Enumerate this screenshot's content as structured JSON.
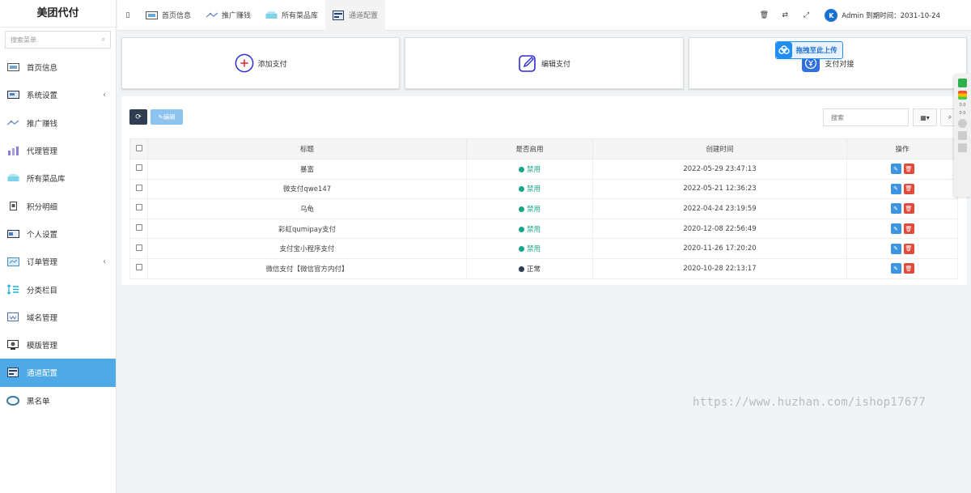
{
  "app": {
    "brand": "美团代付"
  },
  "sidebar": {
    "search_placeholder": "搜索菜单",
    "items": [
      {
        "label": "首页信息",
        "icon": "home-monitor-icon",
        "arrow": ""
      },
      {
        "label": "系统设置",
        "icon": "system-settings-icon",
        "arrow": "‹"
      },
      {
        "label": "推广赚钱",
        "icon": "promote-icon",
        "arrow": ""
      },
      {
        "label": "代理管理",
        "icon": "agent-chart-icon",
        "arrow": ""
      },
      {
        "label": "所有菜品库",
        "icon": "dishes-icon",
        "arrow": ""
      },
      {
        "label": "积分明细",
        "icon": "points-icon",
        "arrow": ""
      },
      {
        "label": "个人设置",
        "icon": "profile-icon",
        "arrow": ""
      },
      {
        "label": "订单管理",
        "icon": "orders-icon",
        "arrow": "‹"
      },
      {
        "label": "分类栏目",
        "icon": "category-icon",
        "arrow": ""
      },
      {
        "label": "域名管理",
        "icon": "domain-icon",
        "arrow": ""
      },
      {
        "label": "模版管理",
        "icon": "template-icon",
        "arrow": ""
      },
      {
        "label": "通道配置",
        "icon": "channel-icon",
        "arrow": ""
      },
      {
        "label": "黑名单",
        "icon": "blacklist-icon",
        "arrow": ""
      }
    ],
    "active_index": 11
  },
  "topbar": {
    "toggle": "▯",
    "tabs": [
      {
        "label": "首页信息",
        "icon": "home-monitor-icon"
      },
      {
        "label": "推广赚钱",
        "icon": "promote-icon"
      },
      {
        "label": "所有菜品库",
        "icon": "dishes-icon"
      },
      {
        "label": "通道配置",
        "icon": "channel-icon"
      }
    ],
    "active_tab": 3,
    "user_text": "Admin 到期时间：2031-10-24"
  },
  "cards": {
    "add_label": "添加支付",
    "edit_label": "编辑支付",
    "connect_label": "支付对接",
    "upload_tip": "拖拽至此上传"
  },
  "panel": {
    "edit_button": "编辑",
    "search_placeholder": "搜索",
    "columns": [
      "标题",
      "是否启用",
      "创建时间",
      "操作"
    ],
    "rows": [
      {
        "title": "暴富",
        "status": "禁用",
        "status_type": "off",
        "created": "2022-05-29 23:47:13"
      },
      {
        "title": "微支付qwe147",
        "status": "禁用",
        "status_type": "off",
        "created": "2022-05-21 12:36:23"
      },
      {
        "title": "乌龟",
        "status": "禁用",
        "status_type": "off",
        "created": "2022-04-24 23:19:59"
      },
      {
        "title": "彩虹qumipay支付",
        "status": "禁用",
        "status_type": "off",
        "created": "2020-12-08 22:56:49"
      },
      {
        "title": "支付宝小程序支付",
        "status": "禁用",
        "status_type": "off",
        "created": "2020-11-26 17:20:20"
      },
      {
        "title": "微信支付【微信官方内付】",
        "status": "正常",
        "status_type": "on",
        "created": "2020-10-28 22:13:17"
      }
    ]
  },
  "colors": {
    "accent": "#4fa9e6",
    "disabled": "#18a689",
    "enabled": "#2e3d4f",
    "danger": "#e24b3b"
  },
  "floatbar": {
    "readout_1": "0.0",
    "readout_2": "0.0"
  },
  "watermark": "https://www.huzhan.com/ishop17677"
}
